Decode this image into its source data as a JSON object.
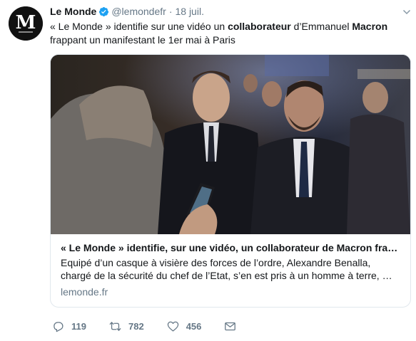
{
  "tweet": {
    "author_name": "Le Monde",
    "handle": "@lemondefr",
    "separator": "·",
    "date": "18 juil.",
    "avatar_logo": "M",
    "text_parts": {
      "p1": "« Le Monde » identifie sur une vidéo un ",
      "bold1": "collaborateur",
      "p2": " d’Emmanuel ",
      "bold2": "Macron",
      "p3": " frappant un manifestant le 1er mai à Paris"
    }
  },
  "card": {
    "title": "« Le Monde » identifie, sur une vidéo, un collaborateur de Macron fra…",
    "description": "Equipé d’un casque à visière des forces de l’ordre, Alexandre Benalla, chargé de la sécurité du chef de l’Etat, s’en est pris à un homme à terre, …",
    "domain": "lemonde.fr",
    "image_subject": "photo-crowd-scene"
  },
  "actions": {
    "reply_count": "119",
    "retweet_count": "782",
    "like_count": "456"
  },
  "icons": {
    "verified": "verified-badge-icon",
    "reply": "reply-icon",
    "retweet": "retweet-icon",
    "like": "heart-icon",
    "message": "envelope-icon",
    "more": "chevron-down-icon"
  },
  "colors": {
    "accent": "#1da1f2",
    "muted": "#657786",
    "text": "#14171a",
    "border": "#e1e8ed"
  }
}
